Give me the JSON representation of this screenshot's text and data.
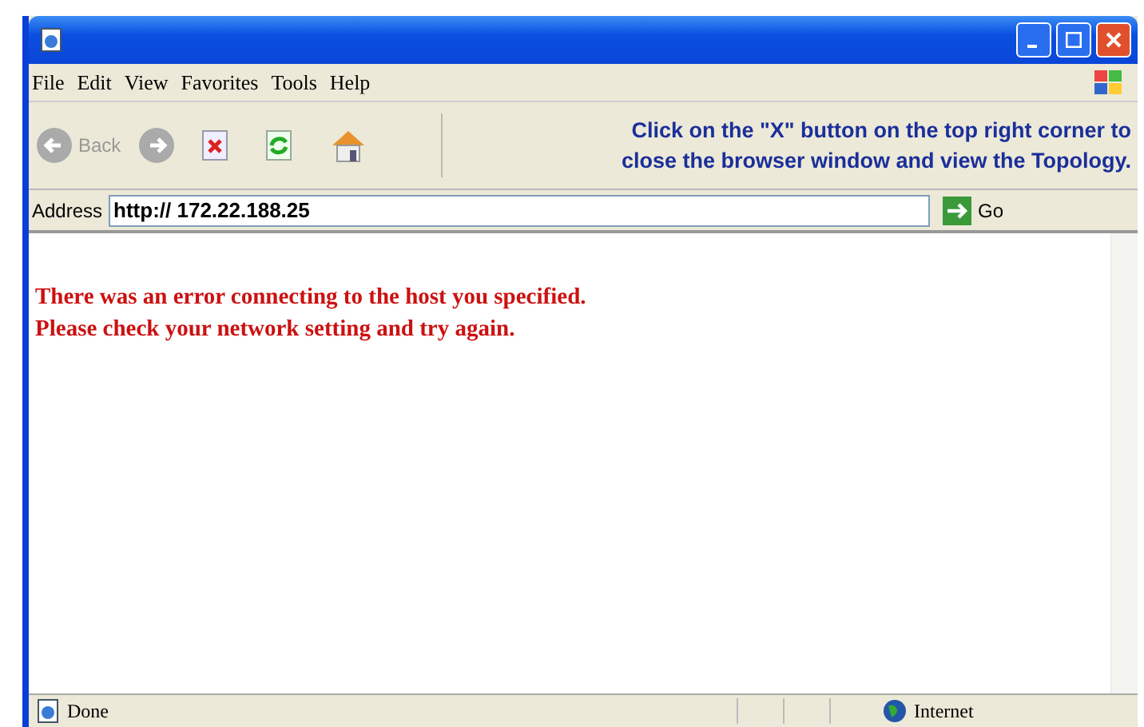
{
  "menu": [
    "File",
    "Edit",
    "View",
    "Favorites",
    "Tools",
    "Help"
  ],
  "toolbar": {
    "back": {
      "label": "Back",
      "disabled": true
    },
    "forward": {
      "disabled": true
    }
  },
  "hint": [
    "Click on the \"X\" button on the top right corner to",
    "close the browser window and view the Topology."
  ],
  "address": {
    "label": "Address",
    "value": "http:// 172.22.188.25",
    "go": "Go"
  },
  "error_lines": [
    "There was an error connecting to the host you specified.",
    "Please check your network setting and try again."
  ],
  "status_bar": {
    "text": "Done",
    "zone": "Internet"
  }
}
